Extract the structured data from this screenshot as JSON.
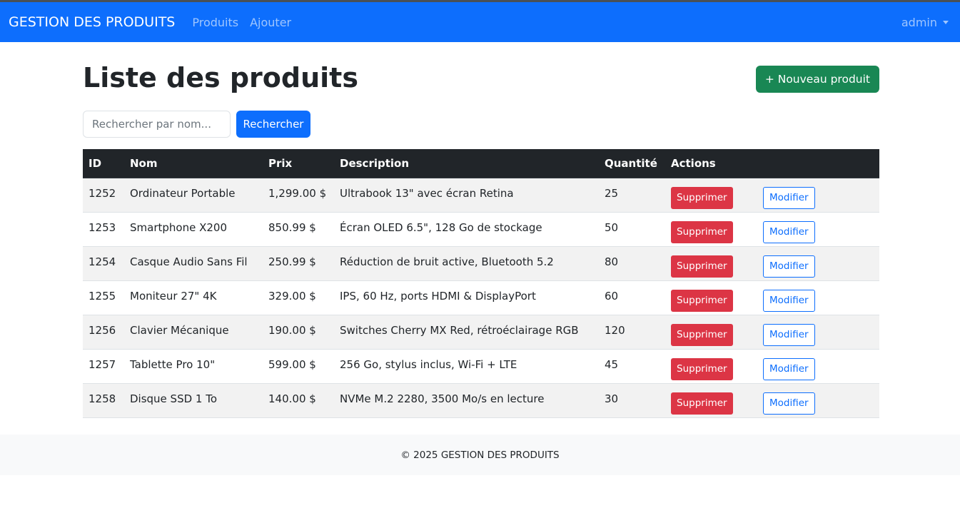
{
  "navbar": {
    "brand": "GESTION DES PRODUITS",
    "links": [
      "Produits",
      "Ajouter"
    ],
    "user": "admin",
    "color": "#0d6efd"
  },
  "page": {
    "title": "Liste des produits",
    "new_button": "+ Nouveau produit"
  },
  "search": {
    "placeholder": "Rechercher par nom...",
    "button": "Rechercher"
  },
  "table": {
    "headers": [
      "ID",
      "Nom",
      "Prix",
      "Description",
      "Quantité",
      "Actions"
    ],
    "delete_label": "Supprimer",
    "edit_label": "Modifier",
    "rows": [
      {
        "id": "1252",
        "nom": "Ordinateur Portable",
        "prix": "1,299.00 $",
        "description": "Ultrabook 13\" avec écran Retina",
        "quantite": "25"
      },
      {
        "id": "1253",
        "nom": "Smartphone X200",
        "prix": "850.99 $",
        "description": "Écran OLED 6.5\", 128 Go de stockage",
        "quantite": "50"
      },
      {
        "id": "1254",
        "nom": "Casque Audio Sans Fil",
        "prix": "250.99 $",
        "description": "Réduction de bruit active, Bluetooth 5.2",
        "quantite": "80"
      },
      {
        "id": "1255",
        "nom": "Moniteur 27\" 4K",
        "prix": "329.00 $",
        "description": "IPS, 60 Hz, ports HDMI & DisplayPort",
        "quantite": "60"
      },
      {
        "id": "1256",
        "nom": "Clavier Mécanique",
        "prix": "190.00 $",
        "description": "Switches Cherry MX Red, rétroéclairage RGB",
        "quantite": "120"
      },
      {
        "id": "1257",
        "nom": "Tablette Pro 10\"",
        "prix": "599.00 $",
        "description": "256 Go, stylus inclus, Wi-Fi + LTE",
        "quantite": "45"
      },
      {
        "id": "1258",
        "nom": "Disque SSD 1 To",
        "prix": "140.00 $",
        "description": "NVMe M.2 2280, 3500 Mo/s en lecture",
        "quantite": "30"
      }
    ]
  },
  "footer": {
    "text": "© 2025 GESTION DES PRODUITS"
  }
}
